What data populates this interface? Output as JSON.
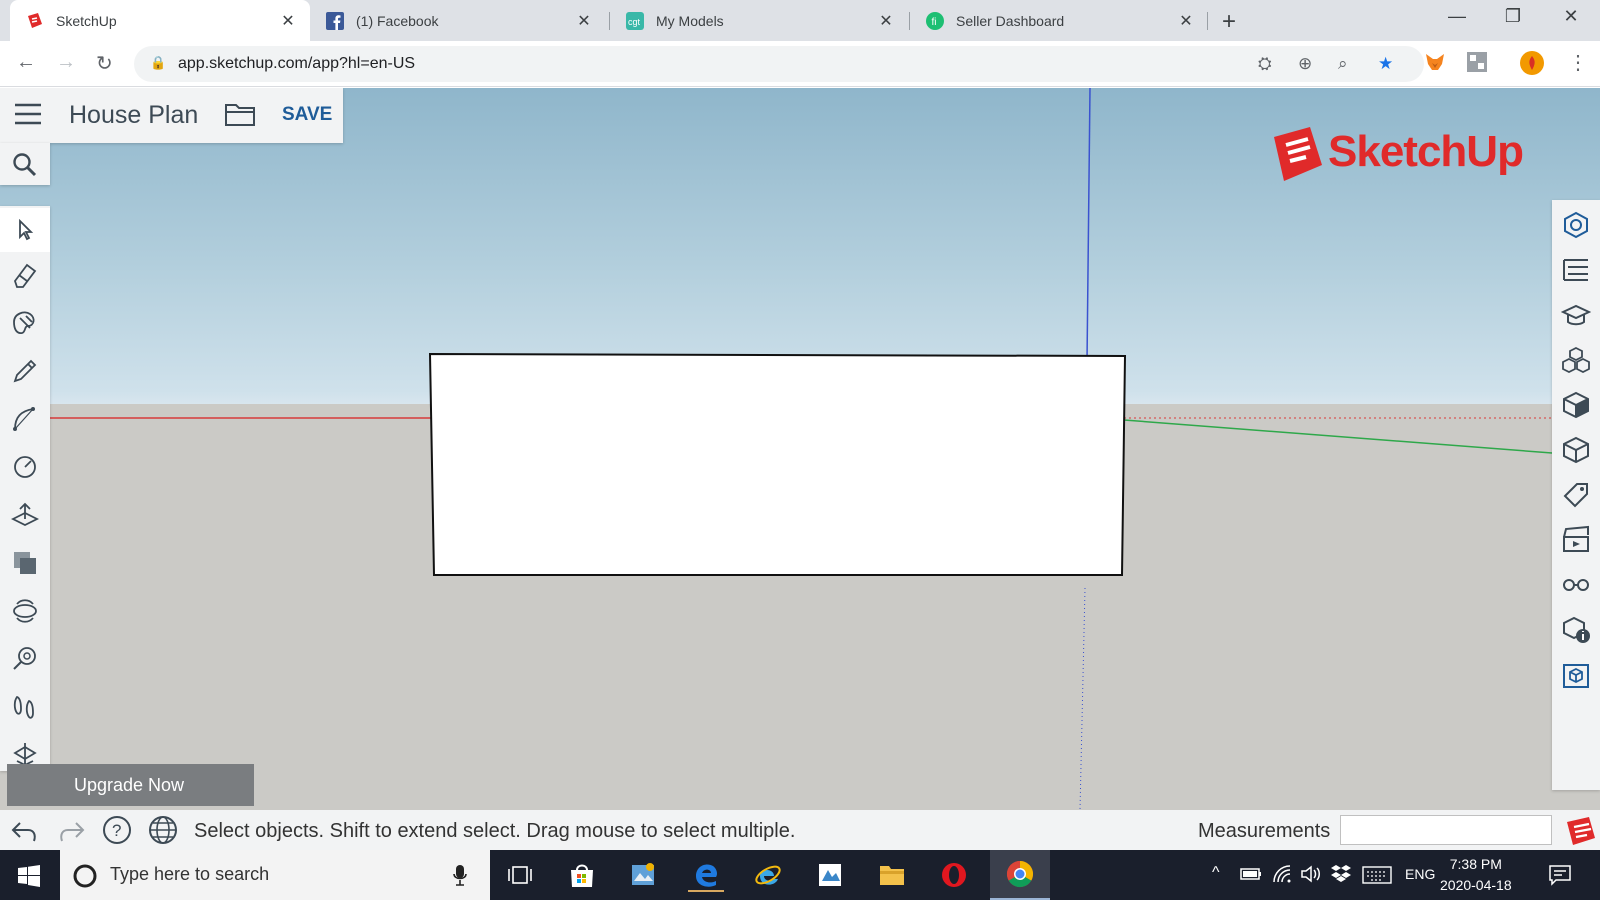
{
  "browser": {
    "tabs": [
      {
        "title": "SketchUp",
        "active": true
      },
      {
        "title": "(1) Facebook",
        "active": false
      },
      {
        "title": "My Models",
        "active": false
      },
      {
        "title": "Seller Dashboard",
        "active": false
      }
    ],
    "url": "app.sketchup.com/app?hl=en-US"
  },
  "app": {
    "model_name": "House Plan",
    "save_label": "SAVE",
    "logo_text": "SketchUp",
    "upgrade_label": "Upgrade Now",
    "status_text": "Select objects. Shift to extend select. Drag mouse to select multiple.",
    "measurements_label": "Measurements",
    "left_tools": [
      "select-tool",
      "eraser-tool",
      "paint-tool",
      "line-tool",
      "arc-tool",
      "circle-tool",
      "push-pull-tool",
      "offset-tool",
      "orbit-tool",
      "tape-measure-tool",
      "walk-tool",
      "section-tool"
    ],
    "right_panels": [
      "entity-info-icon",
      "outliner-icon",
      "instructor-icon",
      "components-icon",
      "materials-icon",
      "styles-icon",
      "tags-icon",
      "scenes-icon",
      "display-icon",
      "model-info-icon",
      "3d-warehouse-icon"
    ]
  },
  "taskbar": {
    "search_placeholder": "Type here to search",
    "language": "ENG",
    "time": "7:38 PM",
    "date": "2020-04-18"
  },
  "colors": {
    "sketchup_red": "#e02a2a",
    "save_blue": "#1f5c99",
    "axis_red": "#d83a3a",
    "axis_green": "#2ea84a",
    "axis_blue": "#3a52d0"
  }
}
